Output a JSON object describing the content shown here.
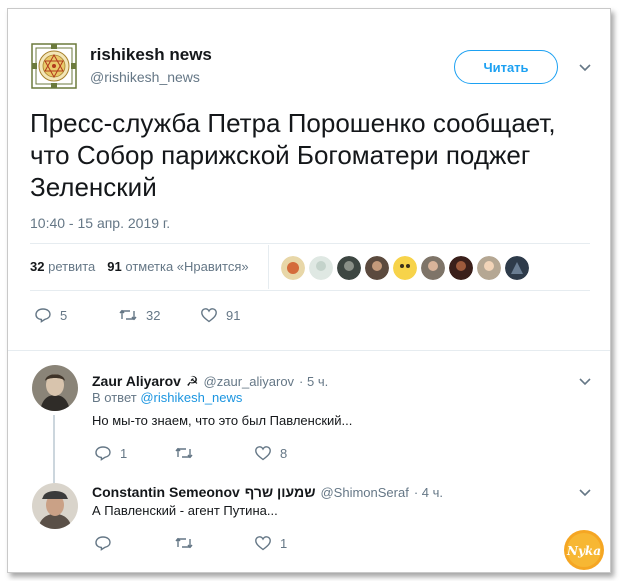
{
  "tweet": {
    "author_name": "rishikesh news",
    "author_handle": "@rishikesh_news",
    "follow_label": "Читать",
    "text": "Пресс-служба Петра Порошенко сообщает, что Собор парижской Богоматери поджег Зеленский",
    "timestamp": "10:40 - 15 апр. 2019 г.",
    "retweets_count": "32",
    "retweets_label": "ретвита",
    "likes_count": "91",
    "likes_label": "отметка «Нравится»",
    "actions": {
      "replies": "5",
      "retweets": "32",
      "likes": "91"
    }
  },
  "replies": [
    {
      "name": "Zaur Aliyarov",
      "name_emoji": "☭",
      "handle": "@zaur_aliyarov",
      "time": "· 5 ч.",
      "reply_to_prefix": "В ответ",
      "reply_to_handle": "@rishikesh_news",
      "text": "Но мы-то знаем, что это был Павленский...",
      "actions": {
        "replies": "1",
        "retweets": "",
        "likes": "8"
      }
    },
    {
      "name": "Constantin Semeonov",
      "name_hebrew": "שמעון שרף",
      "handle": "@ShimonSeraf",
      "time": "· 4 ч.",
      "text": "А Павленский - агент Путина...",
      "actions": {
        "replies": "",
        "retweets": "",
        "likes": "1"
      }
    }
  ],
  "watermark_text": "Nyka",
  "colors": {
    "accent": "#1da1f2",
    "link": "#1b95e0",
    "muted": "#657786",
    "text": "#14171a"
  }
}
